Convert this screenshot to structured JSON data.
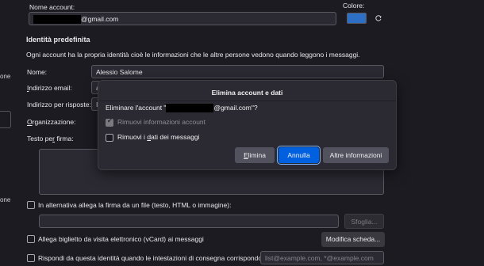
{
  "account": {
    "name_label": "Nome account:",
    "name_value_suffix": "@gmail.com",
    "color_label": "Colore:",
    "color_value": "#2d6fc4"
  },
  "identity": {
    "title": "Identità predefinita",
    "description": "Ogni account ha la propria identità cioè le informazioni che le altre persone vedono quando leggono i messaggi.",
    "name_label": "Nome:",
    "name_value": "Alessio Salome",
    "email_label": "Indirizzo email:",
    "email_value": "a",
    "reply_label": "Indirizzo per risposte:",
    "reply_value": "I",
    "org_label": "Organizzazione:",
    "signature_label": "Testo per firma:"
  },
  "options": {
    "attach_signature_label": "In alternativa allega la firma da un file (testo, HTML o immagine):",
    "browse_label": "Sfoglia...",
    "vcard_label": "Allega biglietto da visita elettronico (vCard) ai messaggi",
    "edit_card_label": "Modifica scheda...",
    "reply_identity_label": "Rispondi da questa identità quando le intestazioni di consegna corrispondono:",
    "reply_identity_placeholder": "list@example.com, *@example.com"
  },
  "sidebar_fragments": [
    "one",
    "one"
  ],
  "dialog": {
    "title": "Elimina account e dati",
    "question_prefix": "Eliminare l'account \"",
    "question_suffix": "@gmail.com\"?",
    "remove_info_label": "Rimuovi informazioni account",
    "remove_info_checked": true,
    "remove_data_label": "Rimuovi i dati dei messaggi",
    "remove_data_checked": false,
    "delete_label": "Elimina",
    "cancel_label": "Annulla",
    "more_label": "Altre informazioni"
  }
}
